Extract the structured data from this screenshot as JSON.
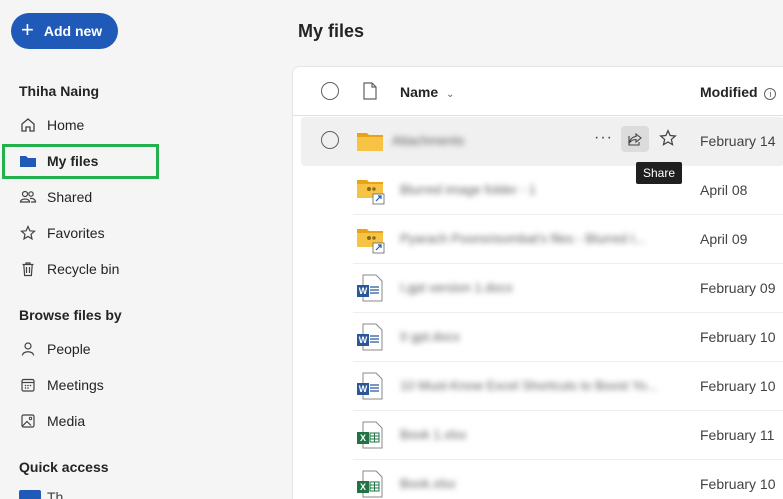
{
  "sidebar": {
    "add_new": "Add new",
    "user_name": "Thiha Naing",
    "items": [
      {
        "label": "Home",
        "icon": "home-icon"
      },
      {
        "label": "My files",
        "icon": "folder-icon"
      },
      {
        "label": "Shared",
        "icon": "people-icon"
      },
      {
        "label": "Favorites",
        "icon": "star-icon"
      },
      {
        "label": "Recycle bin",
        "icon": "trash-icon"
      }
    ],
    "browse_title": "Browse files by",
    "browse_items": [
      {
        "label": "People",
        "icon": "person-icon"
      },
      {
        "label": "Meetings",
        "icon": "calendar-icon"
      },
      {
        "label": "Media",
        "icon": "image-icon"
      }
    ],
    "quick_access_title": "Quick access",
    "quick_access_stub": "Th..."
  },
  "main": {
    "title": "My files",
    "columns": {
      "name": "Name",
      "modified": "Modified"
    },
    "share_tooltip": "Share",
    "files": [
      {
        "name": "Attachments",
        "type": "folder",
        "modified": "February 14"
      },
      {
        "name": "Blurred image folder - 1",
        "type": "shared-folder",
        "modified": "April 08"
      },
      {
        "name": "Pyarach Poonsrisombat's files - Blurred I...",
        "type": "shared-folder",
        "modified": "April 09"
      },
      {
        "name": "I.gpt version 1.docx",
        "type": "word",
        "modified": "February 09"
      },
      {
        "name": "II gpt.docx",
        "type": "word",
        "modified": "February 10"
      },
      {
        "name": "10 Must-Know Excel Shortcuts to Boost Yo...",
        "type": "word",
        "modified": "February 10"
      },
      {
        "name": "Book 1.xlsx",
        "type": "excel",
        "modified": "February 11"
      },
      {
        "name": "Book.xlsx",
        "type": "excel",
        "modified": "February 10"
      }
    ]
  }
}
